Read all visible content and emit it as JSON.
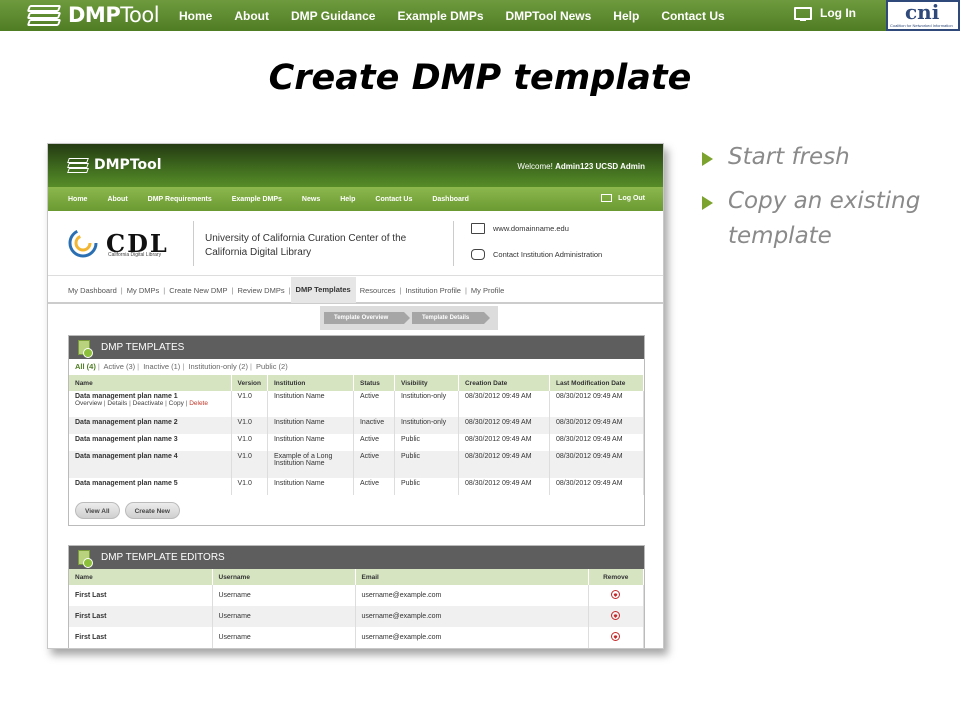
{
  "topbar": {
    "logo_bold": "DMP",
    "logo_thin": "Tool",
    "nav": [
      "Home",
      "About",
      "DMP Guidance",
      "Example DMPs",
      "DMPTool News",
      "Help",
      "Contact Us"
    ],
    "login": "Log In",
    "partner_logo": "cni",
    "partner_subtitle": "Coalition for Networked Information"
  },
  "slide": {
    "title": "Create DMP template",
    "bullets": [
      "Start fresh",
      "Copy an existing template"
    ]
  },
  "screenshot": {
    "header": {
      "logo": "DMPTool",
      "welcome_prefix": "Welcome!",
      "welcome_user": "Admin123 UCSD Admin"
    },
    "nav": [
      "Home",
      "About",
      "DMP Requirements",
      "Example DMPs",
      "News",
      "Help",
      "Contact Us",
      "Dashboard"
    ],
    "logout": "Log Out",
    "institution": {
      "logo_text": "CDL",
      "logo_sub": "California Digital Library",
      "name": "University of California Curation Center of the California Digital Library",
      "website": "www.domainname.edu",
      "contact": "Contact Institution Administration"
    },
    "subnav": [
      "My Dashboard",
      "My DMPs",
      "Create New DMP",
      "Review DMPs",
      "DMP Templates",
      "Resources",
      "Institution Profile",
      "My Profile"
    ],
    "breadcrumbs": [
      "Template Overview",
      "Template Details"
    ],
    "templates_panel": {
      "title": "DMP TEMPLATES",
      "filters": [
        "All (4)",
        "Active (3)",
        "Inactive (1)",
        "Institution-only (2)",
        "Public (2)"
      ],
      "columns": [
        "Name",
        "Version",
        "Institution",
        "Status",
        "Visibility",
        "Creation Date",
        "Last Modification Date"
      ],
      "rows": [
        {
          "name": "Data management plan name 1",
          "version": "V1.0",
          "institution": "Institution Name",
          "status": "Active",
          "visibility": "Institution-only",
          "created": "08/30/2012 09:49 AM",
          "modified": "08/30/2012 09:49 AM"
        },
        {
          "name": "Data management plan name 2",
          "version": "V1.0",
          "institution": "Institution Name",
          "status": "Inactive",
          "visibility": "Institution-only",
          "created": "08/30/2012 09:49 AM",
          "modified": "08/30/2012 09:49 AM"
        },
        {
          "name": "Data management plan name 3",
          "version": "V1.0",
          "institution": "Institution Name",
          "status": "Active",
          "visibility": "Public",
          "created": "08/30/2012 09:49 AM",
          "modified": "08/30/2012 09:49 AM"
        },
        {
          "name": "Data management plan name 4",
          "version": "V1.0",
          "institution": "Example of a Long Institution Name",
          "status": "Active",
          "visibility": "Public",
          "created": "08/30/2012 09:49 AM",
          "modified": "08/30/2012 09:49 AM"
        },
        {
          "name": "Data management plan name 5",
          "version": "V1.0",
          "institution": "Institution Name",
          "status": "Active",
          "visibility": "Public",
          "created": "08/30/2012 09:49 AM",
          "modified": "08/30/2012 09:49 AM"
        }
      ],
      "row_actions": [
        "Overview",
        "Details",
        "Deactivate",
        "Copy",
        "Delete"
      ],
      "buttons": [
        "View All",
        "Create New"
      ]
    },
    "editors_panel": {
      "title": "DMP TEMPLATE EDITORS",
      "columns": [
        "Name",
        "Username",
        "Email",
        "Remove"
      ],
      "rows": [
        {
          "name": "First Last",
          "username": "Username",
          "email": "username@example.com"
        },
        {
          "name": "First Last",
          "username": "Username",
          "email": "username@example.com"
        },
        {
          "name": "First Last",
          "username": "Username",
          "email": "username@example.com"
        }
      ]
    }
  },
  "colors": {
    "brand_green": "#5a8a2c",
    "bullet_arrow": "#7ba32e",
    "panel_header": "#5e5e5e",
    "table_header": "#d6e4c2",
    "delete_red": "#c0392b"
  }
}
